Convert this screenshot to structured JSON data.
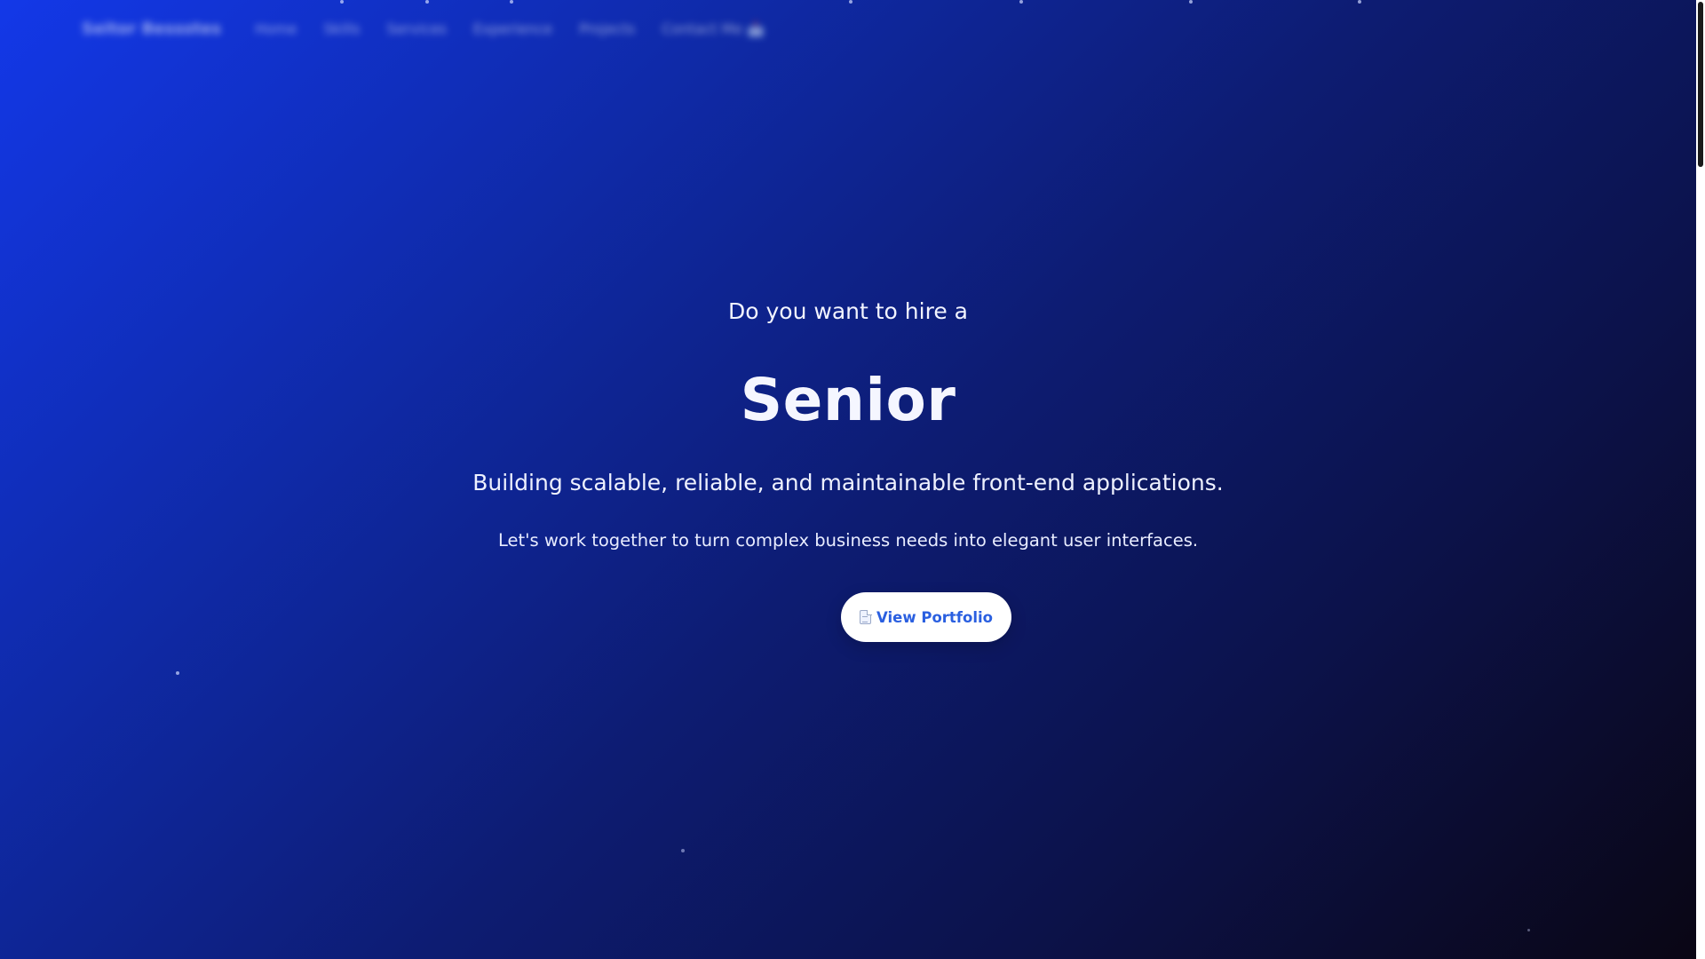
{
  "nav": {
    "brand": "Seitor Bessstes",
    "links": [
      "Home",
      "Skills",
      "Services",
      "Experience",
      "Projects",
      "Contact Me 📩"
    ]
  },
  "hero": {
    "pretitle": "Do you want to hire a",
    "headline": "Senior",
    "tagline": "Building scalable, reliable, and maintainable front-end applications.",
    "subline": "Let's work together to turn complex business needs into elegant user interfaces.",
    "cta_label": "View Portfolio",
    "cta_icon": "document-icon"
  },
  "colors": {
    "gradient_start": "#1338e8",
    "gradient_end": "#0a0614",
    "cta_background": "#ffffff",
    "cta_text": "#2a5fe0"
  }
}
